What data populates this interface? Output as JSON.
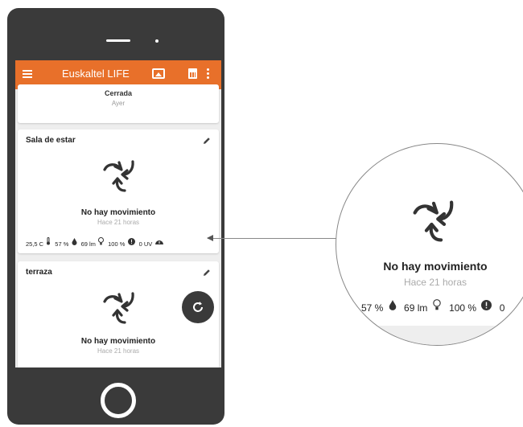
{
  "app": {
    "title": "Euskaltel LIFE",
    "accent_color": "#e8702a"
  },
  "icons": {
    "menu": "hamburger-menu-icon",
    "image": "image-icon",
    "calendar": "calendar-icon",
    "more": "more-vertical-icon",
    "edit": "pencil-icon",
    "motion": "motion-arrows-icon",
    "refresh": "refresh-icon"
  },
  "cards": [
    {
      "state": "Cerrada",
      "time": "Ayer"
    },
    {
      "title": "Sala de estar",
      "motion_state": "No hay movimiento",
      "motion_time": "Hace 21 horas",
      "stats": {
        "temp": "25,5 C",
        "humidity": "57 %",
        "light": "69 lm",
        "battery": "100 %",
        "uv": "0 UV"
      }
    },
    {
      "title": "terraza",
      "motion_state": "No hay movimiento",
      "motion_time": "Hace 21 horas"
    }
  ],
  "zoom": {
    "motion_state": "No hay movimiento",
    "motion_time": "Hace 21 horas",
    "stats": {
      "humidity": "57 %",
      "light": "69 lm",
      "battery": "100 %",
      "uv": "0"
    }
  }
}
